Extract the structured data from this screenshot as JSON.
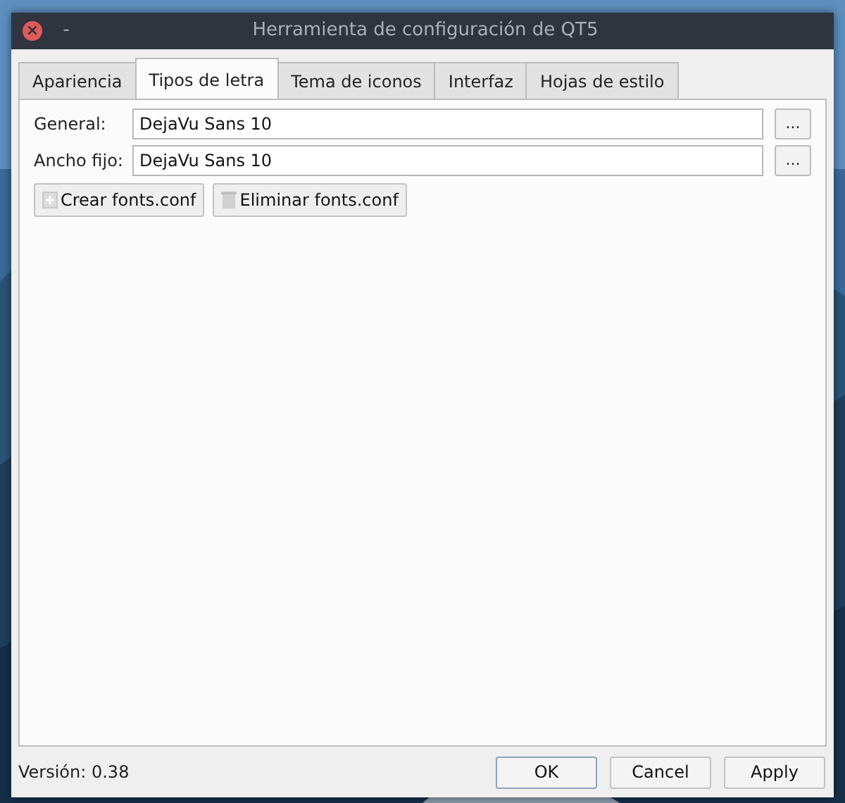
{
  "window": {
    "title": "Herramienta de configuración de QT5",
    "close_symbol": "×",
    "minimize_symbol": "-"
  },
  "tabs": [
    {
      "label": "Apariencia",
      "selected": false
    },
    {
      "label": "Tipos de letra",
      "selected": true
    },
    {
      "label": "Tema de iconos",
      "selected": false
    },
    {
      "label": "Interfaz",
      "selected": false
    },
    {
      "label": "Hojas de estilo",
      "selected": false
    }
  ],
  "fonts": [
    {
      "label": "General:",
      "value": "DejaVu Sans 10",
      "button": "..."
    },
    {
      "label": "Ancho fijo:",
      "value": "DejaVu Sans 10",
      "button": "..."
    }
  ],
  "actions": [
    {
      "label": "Crear fonts.conf",
      "kind": "create"
    },
    {
      "label": "Eliminar fonts.conf",
      "kind": "delete"
    }
  ],
  "status": {
    "version": "Versión: 0.38"
  },
  "buttons": [
    {
      "label": "OK",
      "default": true
    },
    {
      "label": "Cancel",
      "default": false
    },
    {
      "label": "Apply",
      "default": false
    }
  ]
}
